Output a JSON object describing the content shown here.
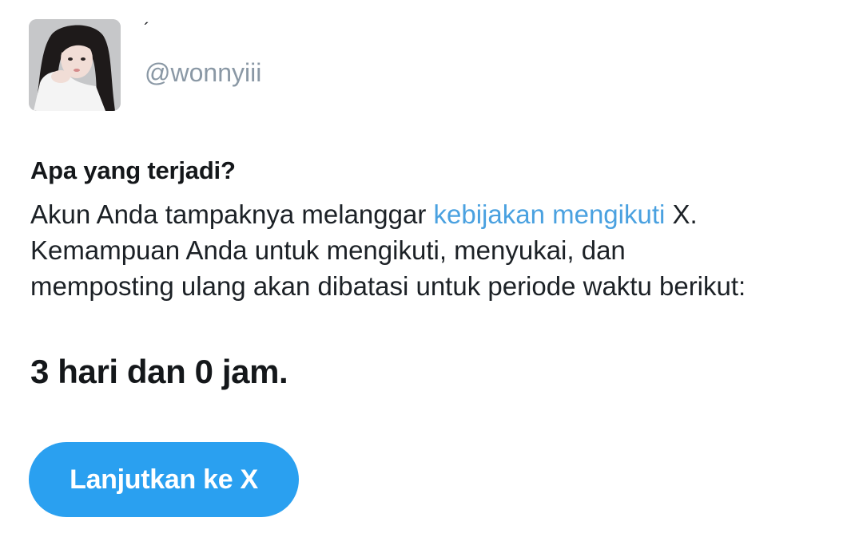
{
  "profile": {
    "display_name": "´",
    "handle": "@wonnyiii",
    "avatar_icon": "user-avatar-photo"
  },
  "notice": {
    "heading": "Apa yang terjadi?",
    "text_before_link": "Akun Anda tampaknya melanggar ",
    "link_text": "kebijakan mengikuti",
    "text_after_link": " X.",
    "line2": "Kemampuan Anda untuk mengikuti, menyukai, dan",
    "line3": "memposting ulang akan dibatasi untuk periode waktu berikut:",
    "duration": "3 hari dan 0 jam."
  },
  "actions": {
    "continue_label": "Lanjutkan ke X"
  },
  "colors": {
    "accent": "#2aa0f0",
    "link": "#4aa1e0",
    "muted": "#8a98a5",
    "text": "#14171a"
  }
}
